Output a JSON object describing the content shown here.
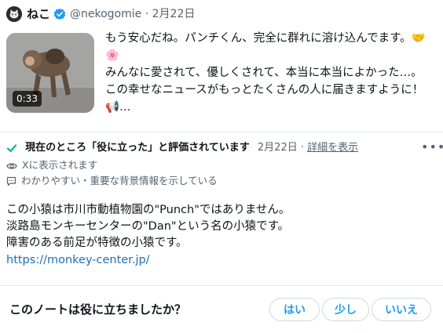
{
  "post": {
    "display_name": "ねこ",
    "handle": "@nekogomie",
    "separator": "·",
    "date": "2月22日",
    "video_duration": "0:33",
    "text": "もう安心だね。パンチくん、完全に群れに溶け込んでます。🤝🌸\nみんなに愛されて、優しくされて、本当に本当によかった…。\nこの幸せなニュースがもっとたくさんの人に届きますように！📢…"
  },
  "note": {
    "status_label": "現在のところ「役に立った」と評価されています",
    "date": "2月22日",
    "separator": "·",
    "details_link": "詳細を表示",
    "shown_on_x": "Xに表示されます",
    "reason": "わかりやすい・重要な背景情報を示している",
    "body_lines": [
      "この小猿は市川市動植物園の\"Punch\"ではありません。",
      "淡路島モンキーセンターの\"Dan\"という名の小猿です。",
      "障害のある前足が特徴の小猿です。"
    ],
    "link": "https://monkey-center.jp/"
  },
  "rating": {
    "question": "このノートは役に立ちましたか？",
    "options": [
      "はい",
      "少し",
      "いいえ"
    ]
  },
  "colors": {
    "accent": "#1d9bf0",
    "verified": "#1d9bf0",
    "helpful_check": "#00ba7c",
    "muted_text": "#536471",
    "link": "#1d6fb8"
  }
}
